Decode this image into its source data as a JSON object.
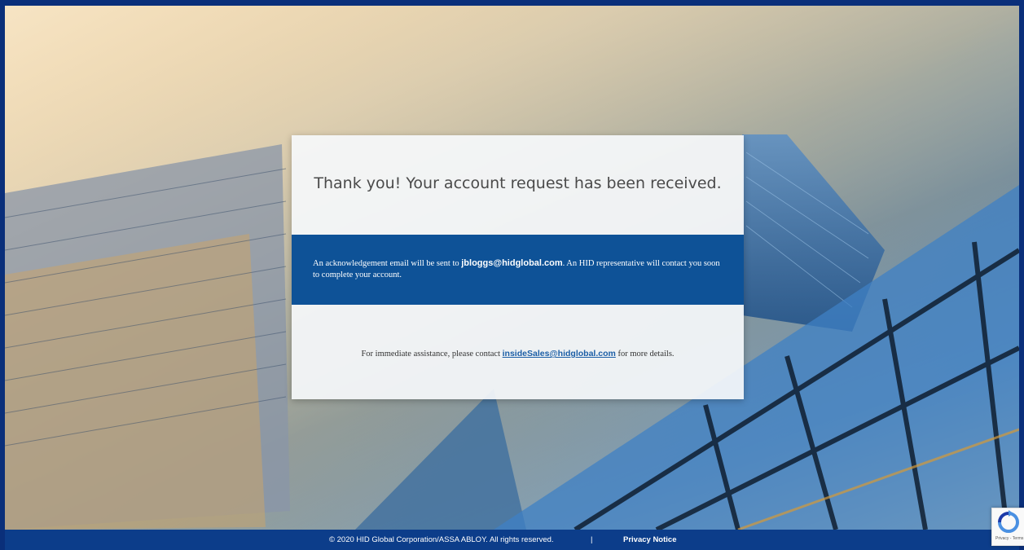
{
  "message": {
    "title": "Thank you! Your account request has been received.",
    "ack_prefix": "An acknowledgement email will be sent to",
    "ack_email": "jbloggs@hidglobal.com",
    "ack_suffix": ". An HID representative will contact you soon to complete your account.",
    "assist_prefix": "For immediate assistance, please contact",
    "assist_email": "insideSales@hidglobal.com",
    "assist_suffix": "for more details."
  },
  "footer": {
    "copyright": "© 2020 HID Global Corporation/ASSA ABLOY. All rights reserved.",
    "separator": "|",
    "privacy_label": "Privacy Notice"
  },
  "recaptcha": {
    "label": "Privacy - Terms",
    "icon": "recaptcha-icon"
  },
  "colors": {
    "band": "#0e5297",
    "footer": "#0c3d8a",
    "link": "#1b5ea6"
  }
}
